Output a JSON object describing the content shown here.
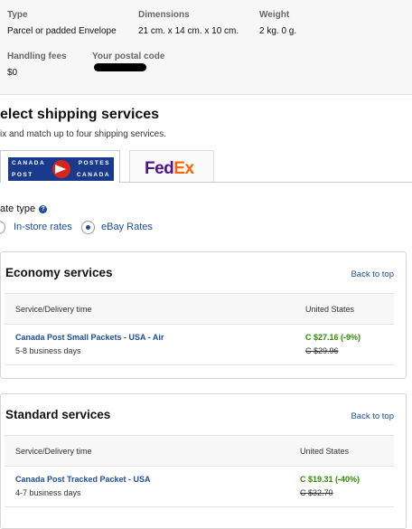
{
  "package": {
    "type_label": "Type",
    "type_value": "Parcel or padded Envelope",
    "dimensions_label": "Dimensions",
    "dimensions_value": "21 cm. x 14 cm. x 10 cm.",
    "weight_label": "Weight",
    "weight_value": "2 kg. 0 g.",
    "handling_label": "Handling fees",
    "handling_value": "$0",
    "postal_label": "Your postal code"
  },
  "section": {
    "title": "elect shipping services",
    "subtitle": "ix and match up to four shipping services."
  },
  "carriers": {
    "canada_post": {
      "line1_left": "CANADA",
      "line1_right": "POSTES",
      "line2_left": "POST",
      "line2_right": "CANADA"
    },
    "fedex": {
      "fe": "Fed",
      "ex": "Ex"
    }
  },
  "rate_type": {
    "label": "ate type",
    "help": "?",
    "options": [
      "In-store rates",
      "eBay Rates"
    ],
    "selected": "eBay Rates"
  },
  "cards": [
    {
      "title": "Economy services",
      "back_link": "Back to top",
      "col_service": "Service/Delivery time",
      "col_dest": "United States",
      "rows": [
        {
          "service": "Canada Post Small Packets - USA - Air",
          "time": "5-8 business days",
          "price": "C $27.16 (-9%)",
          "old_price": "C $29.96"
        }
      ]
    },
    {
      "title": "Standard services",
      "back_link": "Back to top",
      "col_service": "Service/Delivery time",
      "col_dest": "United States",
      "rows": [
        {
          "service": "Canada Post Tracked Packet - USA",
          "time": "4-7 business days",
          "price": "C $19.31 (-40%)",
          "old_price": "C $32.70"
        }
      ]
    }
  ],
  "colors": {
    "link": "#1d4d9e",
    "price_green": "#2e8b00",
    "canada_post_blue": "#1a3a8c",
    "canada_post_red": "#d9261c",
    "fedex_purple": "#4d148c",
    "fedex_orange": "#ff6200"
  }
}
